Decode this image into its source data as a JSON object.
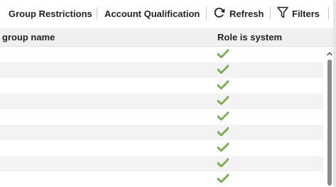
{
  "toolbar": {
    "group_restrictions_label": "Group Restrictions",
    "account_qualification_label": "Account Qualification",
    "refresh_label": "Refresh",
    "filters_label": "Filters",
    "refresh_icon": "refresh-icon",
    "filters_icon": "filter-icon"
  },
  "table": {
    "columns": [
      "group name",
      "Role is system"
    ],
    "rows": [
      {
        "group_name": "",
        "role_is_system": true
      },
      {
        "group_name": "",
        "role_is_system": true
      },
      {
        "group_name": "",
        "role_is_system": true
      },
      {
        "group_name": "",
        "role_is_system": true
      },
      {
        "group_name": "",
        "role_is_system": true
      },
      {
        "group_name": "",
        "role_is_system": true
      },
      {
        "group_name": "",
        "role_is_system": true
      },
      {
        "group_name": "",
        "role_is_system": true
      },
      {
        "group_name": "",
        "role_is_system": true
      }
    ]
  },
  "colors": {
    "check_green": "#6aa13a",
    "header_bg": "#f0f0f0",
    "alt_row_bg": "#f3f3f3"
  }
}
